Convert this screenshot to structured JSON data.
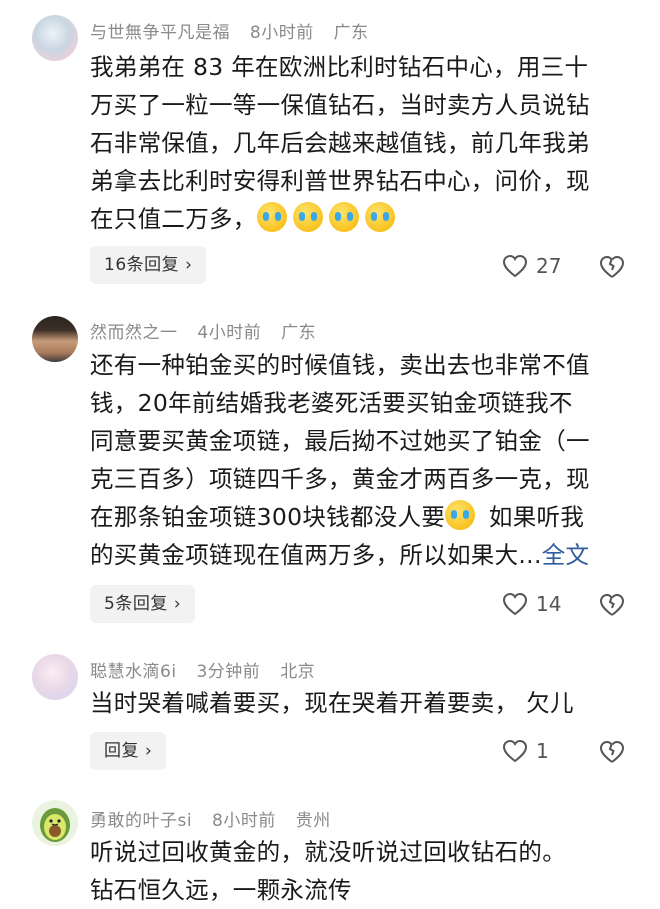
{
  "comments": [
    {
      "username": "与世無争平凡是福",
      "time": "8小时前",
      "location": "广东",
      "lines": [
        "我弟弟在 83 年在欧洲比利时钻石中心，用三十",
        "万买了一粒一等一保值钻石，当时卖方人员说钻",
        "石非常保值，几年后会越来越值钱，前几年我弟",
        "弟拿去比利时安得利普世界钻石中心，问价，现",
        "在只值二万多，"
      ],
      "emoji": "crying-face",
      "reply_label": "16条回复",
      "likes": "27"
    },
    {
      "username": "然而然之一",
      "time": "4小时前",
      "location": "广东",
      "lines": [
        "还有一种铂金买的时候值钱，卖出去也非常不值",
        "钱，20年前结婚我老婆死活要买铂金项链我不",
        "同意要买黄金项链，最后拗不过她买了铂金（一",
        "克三百多）项链四千多，黄金才两百多一克，现",
        "在那条铂金项链300块钱都没人要",
        "的买黄金项链现在值两万多，所以如果大..."
      ],
      "line5_suffix": " 如果听我",
      "full_text_link": "全文",
      "reply_label": "5条回复",
      "likes": "14"
    },
    {
      "username": "聪慧水滴6i",
      "time": "3分钟前",
      "location": "北京",
      "lines": [
        "当时哭着喊着要买，现在哭着开着要卖，  欠儿"
      ],
      "reply_label": "回复",
      "likes": "1"
    },
    {
      "username": "勇敢的叶子si",
      "time": "8小时前",
      "location": "贵州",
      "lines": [
        "听说过回收黄金的，就没听说过回收钻石的。",
        "钻石恒久远，一颗永流传"
      ]
    }
  ],
  "icons": {
    "like": "heart-outline-icon",
    "dislike": "broken-heart-icon",
    "chevron": "chevron-right-icon"
  }
}
